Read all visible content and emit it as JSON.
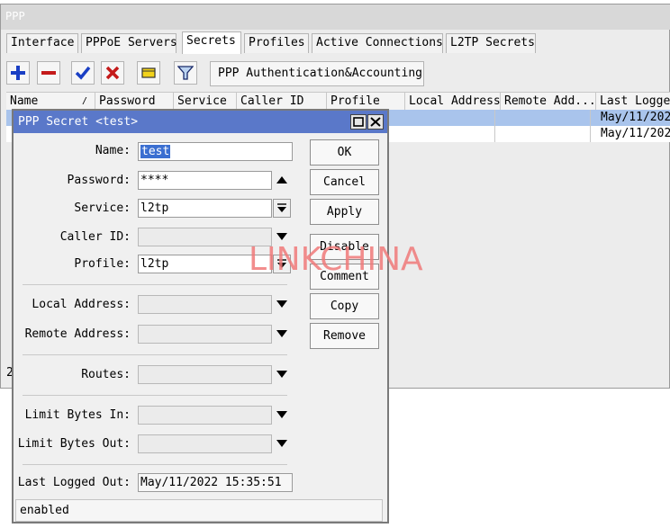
{
  "ppp_window": {
    "title": "PPP",
    "tabs": [
      {
        "label": "Interface"
      },
      {
        "label": "PPPoE Servers"
      },
      {
        "label": "Secrets"
      },
      {
        "label": "Profiles"
      },
      {
        "label": "Active Connections"
      },
      {
        "label": "L2TP Secrets"
      }
    ],
    "toolbar": {
      "auth_button_label": "PPP Authentication&Accounting",
      "icons": [
        "add-icon",
        "remove-icon",
        "enable-check-icon",
        "disable-x-icon",
        "comment-note-icon",
        "filter-icon"
      ]
    },
    "table": {
      "columns": [
        "Name",
        "Password",
        "Service",
        "Caller ID",
        "Profile",
        "Local Address",
        "Remote Add...",
        "Last Logged"
      ],
      "sort_marker": "/",
      "rows": [
        {
          "last_logged": "May/11/202"
        },
        {
          "last_logged": "May/11/202"
        }
      ],
      "count_fragment": "2"
    }
  },
  "dialog": {
    "title": "PPP Secret <test>",
    "fields": {
      "name": {
        "label": "Name:",
        "value": "test"
      },
      "password": {
        "label": "Password:",
        "value": "****"
      },
      "service": {
        "label": "Service:",
        "value": "l2tp"
      },
      "caller_id": {
        "label": "Caller ID:",
        "value": ""
      },
      "profile": {
        "label": "Profile:",
        "value": "l2tp"
      },
      "local_address": {
        "label": "Local Address:",
        "value": ""
      },
      "remote_address": {
        "label": "Remote Address:",
        "value": ""
      },
      "routes": {
        "label": "Routes:",
        "value": ""
      },
      "limit_bytes_in": {
        "label": "Limit Bytes In:",
        "value": ""
      },
      "limit_bytes_out": {
        "label": "Limit Bytes Out:",
        "value": ""
      },
      "last_logged_out": {
        "label": "Last Logged Out:",
        "value": "May/11/2022 15:35:51"
      }
    },
    "buttons": {
      "ok": "OK",
      "cancel": "Cancel",
      "apply": "Apply",
      "disable": "Disable",
      "comment": "Comment",
      "copy": "Copy",
      "remove": "Remove"
    },
    "status": "enabled"
  },
  "watermark": "LINKCHINA",
  "colors": {
    "dialog_titlebar": "#5a78c9",
    "selected_row": "#a9c4ec",
    "add_icon": "#1a3fc4",
    "remove_icon": "#c41a1a",
    "check_icon": "#1a3fc4",
    "x_icon": "#c41a1a",
    "note_icon": "#f2d21a",
    "watermark": "#f07a7a"
  }
}
